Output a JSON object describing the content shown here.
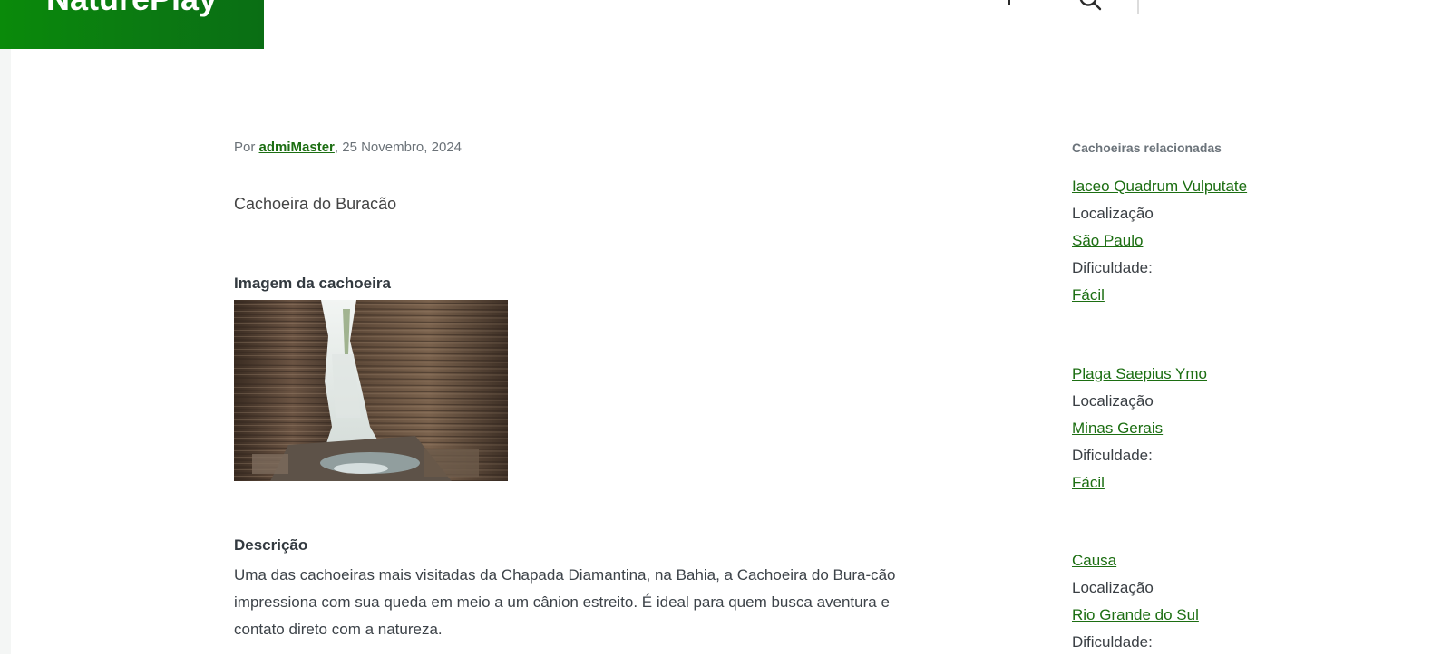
{
  "header": {
    "brand": "NaturePlay"
  },
  "post": {
    "by_prefix": "Por ",
    "author": "admiMaster",
    "date": ", 25 Novembro, 2024",
    "title": "Cachoeira do Buracão",
    "image_label": "Imagem da cachoeira",
    "description_label": "Descrição",
    "description": "Uma das cachoeiras mais visitadas da Chapada Diamantina, na Bahia, a Cachoeira do Bura-cão impressiona com sua queda em meio a um cânion estreito. É ideal para quem busca aventura e contato direto com a natureza."
  },
  "sidebar": {
    "title": "Cachoeiras relacionadas",
    "items": [
      {
        "name": "Iaceo Quadrum Vulputate",
        "location_label": "Localização",
        "location": "São Paulo",
        "difficulty_label": "Dificuldade:",
        "difficulty": "Fácil"
      },
      {
        "name": "Plaga Saepius Ymo",
        "location_label": "Localização",
        "location": "Minas Gerais",
        "difficulty_label": "Dificuldade:",
        "difficulty": "Fácil"
      },
      {
        "name": "Causa",
        "location_label": "Localização",
        "location": "Rio Grande do Sul",
        "difficulty_label": "Dificuldade:"
      }
    ]
  },
  "colors": {
    "brand_green": "#0a8a0a",
    "link_green": "#1c6e12"
  }
}
